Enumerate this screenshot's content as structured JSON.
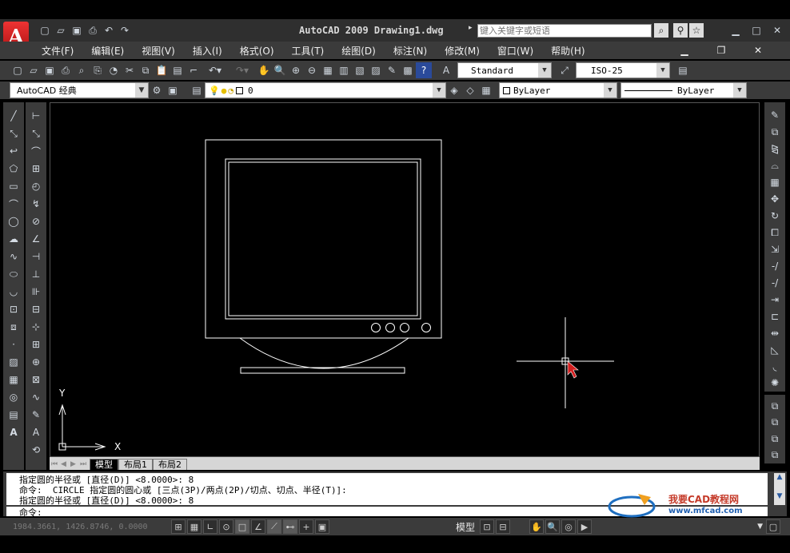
{
  "app": {
    "title": "AutoCAD 2009 Drawing1.dwg",
    "search_placeholder": "键入关键字或短语",
    "logo": "A"
  },
  "menu": [
    "文件(F)",
    "编辑(E)",
    "视图(V)",
    "插入(I)",
    "格式(O)",
    "工具(T)",
    "绘图(D)",
    "标注(N)",
    "修改(M)",
    "窗口(W)",
    "帮助(H)"
  ],
  "toolbar": {
    "text_style": "Standard",
    "dim_style": "ISO-25",
    "workspace": "AutoCAD 经典",
    "layer": "0",
    "color": "ByLayer",
    "linetype": "ByLayer"
  },
  "ucs": {
    "x_label": "X",
    "y_label": "Y"
  },
  "tabs": [
    "模型",
    "布局1",
    "布局2"
  ],
  "command_lines": [
    "指定圆的半径或 [直径(D)] <8.0000>: 8",
    "命令:  CIRCLE 指定圆的圆心或 [三点(3P)/两点(2P)/切点、切点、半径(T)]:",
    "指定圆的半径或 [直径(D)] <8.0000>: 8"
  ],
  "command_prompt": "命令:",
  "status": {
    "coords": "1984.3661, 1426.8746, 0.0000",
    "model_label": "模型"
  },
  "watermark": {
    "title": "我要CAD教程网",
    "url": "www.mfcad.com"
  },
  "colors": {
    "accent": "#c8201e",
    "canvas": "#000000",
    "panel": "#3b3b3b",
    "cursor": "#d42020"
  }
}
